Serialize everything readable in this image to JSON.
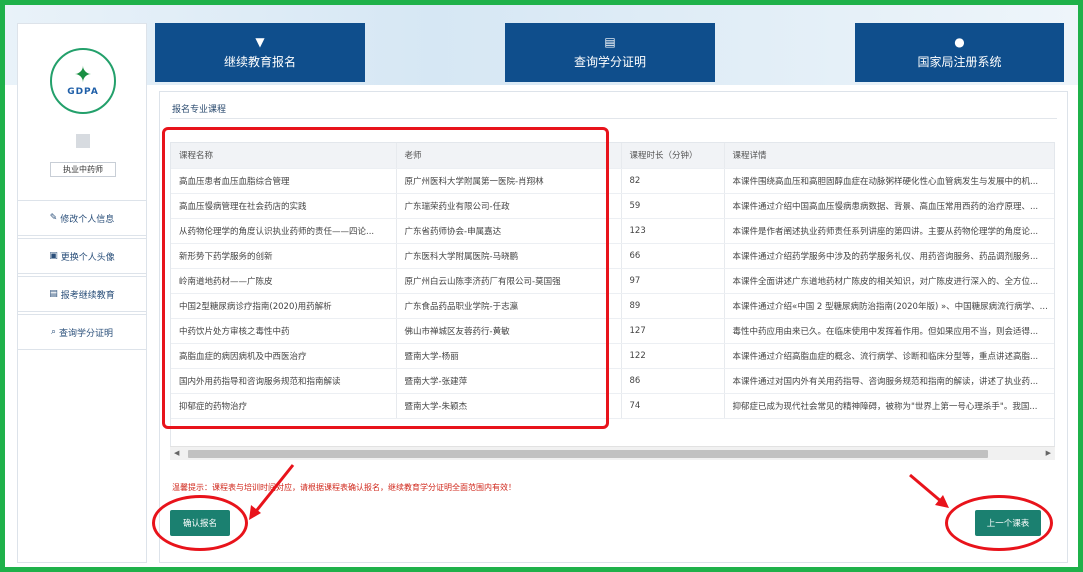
{
  "logo": {
    "abbr": "GDPA"
  },
  "user": {
    "role": "执业中药师"
  },
  "nav": [
    {
      "icon": "edit-icon",
      "label": "修改个人信息"
    },
    {
      "icon": "image-icon",
      "label": "更换个人头像"
    },
    {
      "icon": "doc-icon",
      "label": "报考继续教育"
    },
    {
      "icon": "search-doc-icon",
      "label": "查询学分证明"
    }
  ],
  "tabs": [
    {
      "icon": "cap-icon",
      "label": "继续教育报名"
    },
    {
      "icon": "doc-icon",
      "label": "查询学分证明"
    },
    {
      "icon": "user-icon",
      "label": "国家局注册系统"
    }
  ],
  "section": {
    "title": "报名专业课程"
  },
  "table": {
    "headers": [
      "课程名称",
      "老师",
      "课程时长（分钟）",
      "课程详情"
    ],
    "rows": [
      [
        "高血压患者血压血脂综合管理",
        "原广州医科大学附属第一医院-肖翔林",
        "82",
        "本课件围绕高血压和高胆固醇血症在动脉粥样硬化性心血管病发生与发展中的机..."
      ],
      [
        "高血压慢病管理在社会药店的实践",
        "广东瑞荣药业有限公司-任政",
        "59",
        "本课件通过介绍中国高血压慢病患病数据、背景、高血压常用西药的治疗原理、..."
      ],
      [
        "从药物伦理学的角度认识执业药师的责任——四论...",
        "广东省药师协会-申属嘉达",
        "123",
        "本课件是作者阐述执业药师责任系列讲座的第四讲。主要从药物伦理学的角度论..."
      ],
      [
        "新形势下药学服务的创新",
        "广东医科大学附属医院-马晓鹏",
        "66",
        "本课件通过介绍药学服务中涉及的药学服务礼仪、用药咨询服务、药品调剂服务..."
      ],
      [
        "岭南道地药材——广陈皮",
        "原广州白云山陈李济药厂有限公司-莫国强",
        "97",
        "本课件全面讲述广东道地药材广陈皮的相关知识，对广陈皮进行深入的、全方位..."
      ],
      [
        "中国2型糖尿病诊疗指南(2020)用药解析",
        "广东食品药品职业学院-于志瀛",
        "89",
        "本课件通过介绍«中国 2 型糖尿病防治指南(2020年版) »、中国糖尿病流行病学、..."
      ],
      [
        "中药饮片处方审核之毒性中药",
        "佛山市禅城区友蓉药行-黄敏",
        "127",
        "毒性中药应用由来已久。在临床使用中发挥着作用。但如果应用不当，则会适得..."
      ],
      [
        "高脂血症的病因病机及中西医治疗",
        "暨南大学-杨丽",
        "122",
        "本课件通过介绍高脂血症的概念、流行病学、诊断和临床分型等，重点讲述高脂..."
      ],
      [
        "国内外用药指导和咨询服务规范和指南解读",
        "暨南大学-张建萍",
        "86",
        "本课件通过对国内外有关用药指导、咨询服务规范和指南的解读，讲述了执业药..."
      ],
      [
        "抑郁症的药物治疗",
        "暨南大学-朱颖杰",
        "74",
        "抑郁症已成为现代社会常见的精神障碍，被称为\"世界上第一号心理杀手\"。我国..."
      ]
    ]
  },
  "notice": "温馨提示：课程表与培训时间对应，请根据课程表确认报名，继续教育学分证明全面范围内有效！",
  "buttons": {
    "confirm": "确认报名",
    "prev": "上一个课表"
  }
}
